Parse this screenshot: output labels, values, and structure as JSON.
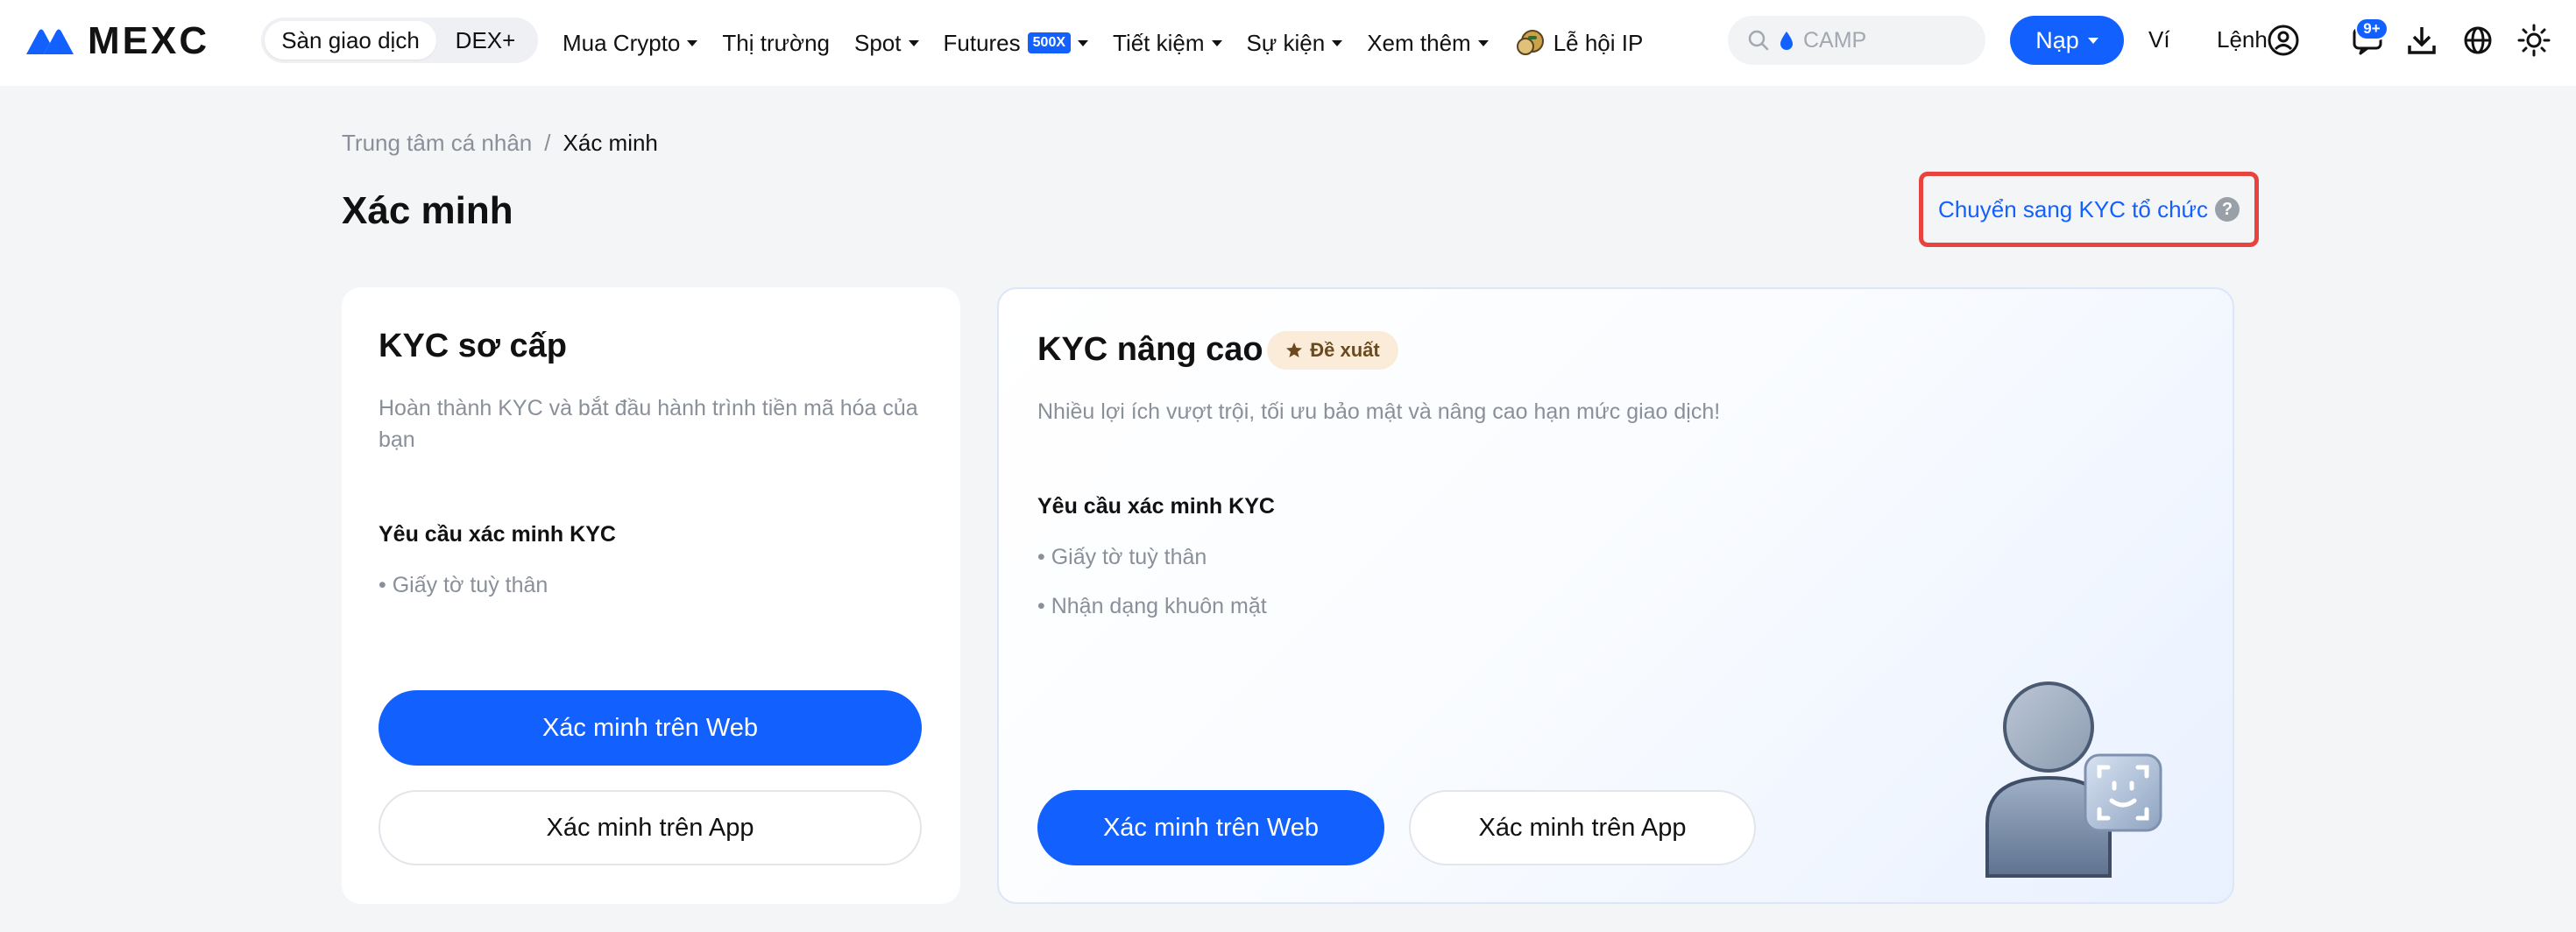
{
  "header": {
    "logo_text": "MEXC",
    "segment": {
      "active": "Sàn giao dịch",
      "other": "DEX+"
    },
    "nav": [
      {
        "label": "Mua Crypto",
        "dropdown": true
      },
      {
        "label": "Thị trường",
        "dropdown": false
      },
      {
        "label": "Spot",
        "dropdown": true
      },
      {
        "label": "Futures",
        "badge": "500X",
        "dropdown": true
      },
      {
        "label": "Tiết kiệm",
        "dropdown": true
      },
      {
        "label": "Sự kiện",
        "dropdown": true
      },
      {
        "label": "Xem thêm",
        "dropdown": true
      },
      {
        "label": "Lễ hội IP",
        "dropdown": false
      }
    ],
    "search_placeholder": "CAMP",
    "deposit_label": "Nạp",
    "wallet_label": "Ví",
    "orders_label": "Lệnh",
    "notification_count": "9+",
    "accent_color": "#1261ff"
  },
  "breadcrumb": {
    "parent": "Trung tâm cá nhân",
    "separator": "/",
    "current": "Xác minh"
  },
  "page_title": "Xác minh",
  "org_kyc_link": "Chuyển sang KYC tổ chức",
  "basic_kyc": {
    "title": "KYC sơ cấp",
    "description": "Hoàn thành KYC và bắt đầu hành trình tiền mã hóa của bạn",
    "requirements_title": "Yêu cầu xác minh KYC",
    "requirements": [
      "Giấy tờ tuỳ thân"
    ],
    "web_button": "Xác minh trên Web",
    "app_button": "Xác minh trên App"
  },
  "advanced_kyc": {
    "title": "KYC nâng cao",
    "badge": "Đề xuất",
    "description": "Nhiều lợi ích vượt trội, tối ưu bảo mật và nâng cao hạn mức giao dịch!",
    "requirements_title": "Yêu cầu xác minh KYC",
    "requirements": [
      "Giấy tờ tuỳ thân",
      "Nhận dạng khuôn mặt"
    ],
    "web_button": "Xác minh trên Web",
    "app_button": "Xác minh trên App"
  }
}
